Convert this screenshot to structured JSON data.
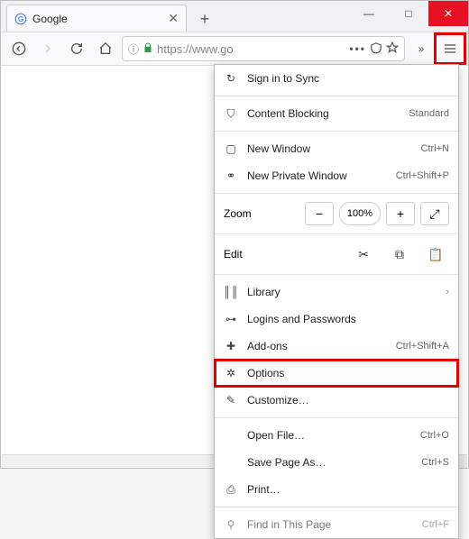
{
  "window": {
    "controls": {
      "minimize": "—",
      "maximize": "□",
      "close": "✕"
    }
  },
  "tab": {
    "title": "Google",
    "close": "✕"
  },
  "newtab": "+",
  "nav": {
    "url": "https://www.go",
    "back": "←",
    "forward": "→",
    "reload": "⟳",
    "home": "⌂",
    "info": "ⓘ",
    "lock": "🔒",
    "dots": "•••",
    "pocket": "⌄",
    "star": "☆",
    "more": "»",
    "menu": "≡"
  },
  "menu": {
    "sync": {
      "label": "Sign in to Sync",
      "icon": "↻"
    },
    "contentBlocking": {
      "label": "Content Blocking",
      "meta": "Standard",
      "icon": "⛉"
    },
    "newWindow": {
      "label": "New Window",
      "meta": "Ctrl+N",
      "icon": "▢"
    },
    "newPrivate": {
      "label": "New Private Window",
      "meta": "Ctrl+Shift+P",
      "icon": "⚭"
    },
    "zoom": {
      "label": "Zoom",
      "minus": "−",
      "pct": "100%",
      "plus": "+",
      "full": "⤢"
    },
    "edit": {
      "label": "Edit",
      "cut": "✂",
      "copy": "⧉",
      "paste": "📋"
    },
    "library": {
      "label": "Library",
      "icon": "║║",
      "chev": "›"
    },
    "logins": {
      "label": "Logins and Passwords",
      "icon": "⊶"
    },
    "addons": {
      "label": "Add-ons",
      "meta": "Ctrl+Shift+A",
      "icon": "✚"
    },
    "options": {
      "label": "Options",
      "icon": "✲"
    },
    "customize": {
      "label": "Customize…",
      "icon": "✎"
    },
    "openFile": {
      "label": "Open File…",
      "meta": "Ctrl+O"
    },
    "savePage": {
      "label": "Save Page As…",
      "meta": "Ctrl+S"
    },
    "print": {
      "label": "Print…",
      "icon": "⎙"
    },
    "find": {
      "label": "Find in This Page",
      "meta": "Ctrl+F",
      "icon": "⚲"
    }
  }
}
